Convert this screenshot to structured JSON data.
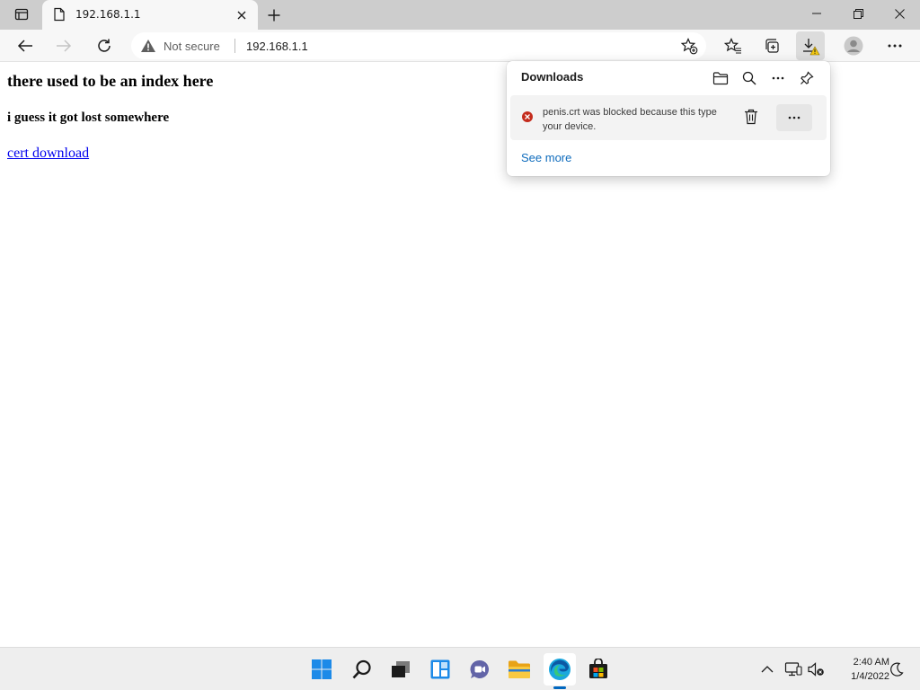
{
  "browser": {
    "tab": {
      "title": "192.168.1.1"
    },
    "address_bar": {
      "security_label": "Not secure",
      "url": "192.168.1.1"
    }
  },
  "page": {
    "heading": "there used to be an index here",
    "subheading": "i guess it got lost somewhere",
    "link_text": "cert download"
  },
  "downloads_panel": {
    "title": "Downloads",
    "item": {
      "message_line1": "penis.crt was blocked because this type",
      "message_line2": "your device."
    },
    "see_more": "See more"
  },
  "taskbar": {
    "apps": [
      "start-icon",
      "search-icon",
      "task-view-icon",
      "widgets-icon",
      "chat-icon",
      "file-explorer-icon",
      "edge-icon",
      "store-icon"
    ],
    "active_app": "edge-icon",
    "time": "2:40 AM",
    "date": "1/4/2022"
  },
  "colors": {
    "link": "#0000ee",
    "accent": "#0f6cbd",
    "error": "#c42b1c",
    "warning": "#f2c811"
  }
}
